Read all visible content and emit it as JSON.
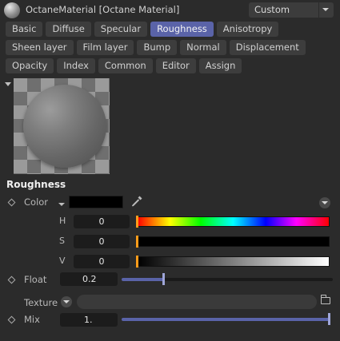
{
  "header": {
    "title": "OctaneMaterial [Octane Material]",
    "mode_value": "Custom"
  },
  "tabs": {
    "row1": [
      "Basic",
      "Diffuse",
      "Specular",
      "Roughness",
      "Anisotropy"
    ],
    "row2": [
      "Sheen layer",
      "Film layer",
      "Bump",
      "Normal",
      "Displacement"
    ],
    "row3": [
      "Opacity",
      "Index",
      "Common",
      "Editor",
      "Assign"
    ],
    "active": "Roughness"
  },
  "section": {
    "title": "Roughness"
  },
  "color": {
    "label": "Color",
    "swatch_hex": "#000000",
    "h_label": "H",
    "h_value": "0",
    "s_label": "S",
    "s_value": "0",
    "v_label": "V",
    "v_value": "0"
  },
  "float": {
    "label": "Float",
    "value": "0.2",
    "fraction": 0.2
  },
  "texture": {
    "label": "Texture",
    "value": ""
  },
  "mix": {
    "label": "Mix",
    "value": "1.",
    "fraction": 1.0
  },
  "colors": {
    "background": "#2b2b2b",
    "tab": "#3d3d3d",
    "tab_active": "#5a63a8",
    "field": "#1c1c1c",
    "slider_fill": "#5a63a8",
    "marker": "#ff9c1a"
  },
  "icons": [
    "material-sphere-icon",
    "dropdown-caret-icon",
    "collapse-arrow-icon",
    "keyframe-diamond-icon",
    "eyedropper-icon",
    "folder-icon"
  ]
}
